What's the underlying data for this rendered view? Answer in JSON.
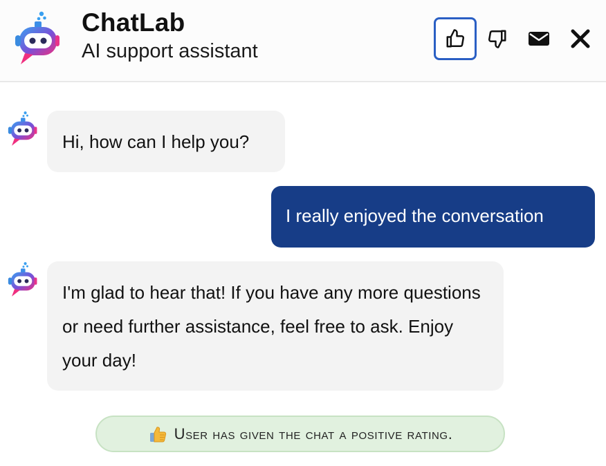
{
  "header": {
    "title": "ChatLab",
    "subtitle": "AI support assistant",
    "logo_icon": "robot-chat-icon",
    "actions": [
      {
        "icon": "thumbs-up-icon",
        "active": true
      },
      {
        "icon": "thumbs-down-icon",
        "active": false
      },
      {
        "icon": "mail-icon",
        "active": false
      },
      {
        "icon": "close-icon",
        "active": false
      }
    ]
  },
  "messages": [
    {
      "sender": "bot",
      "text": "Hi, how can I help you?"
    },
    {
      "sender": "user",
      "text": "I really enjoyed the conversation"
    },
    {
      "sender": "bot",
      "text": "I'm glad to hear that! If you have any more questions or need further assistance, feel free to ask. Enjoy your day!"
    }
  ],
  "rating_notice": {
    "icon": "thumbs-up-emoji",
    "text": "User has given the chat a positive rating."
  },
  "colors": {
    "user_bubble": "#173d87",
    "bot_bubble": "#f3f3f3",
    "active_border": "#2a5fc4",
    "rating_bg": "#e1f1df",
    "logo_blue": "#3b8ee8",
    "logo_pink": "#e8338a"
  }
}
